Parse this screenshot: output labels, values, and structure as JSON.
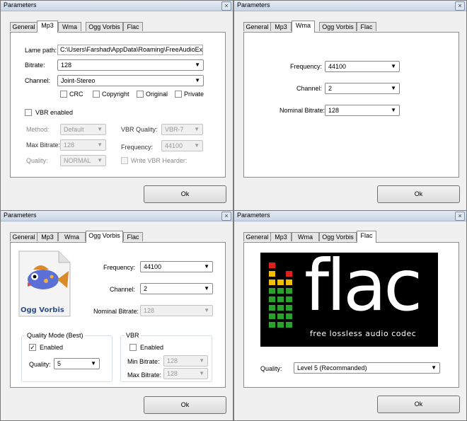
{
  "tabs": [
    "General",
    "Mp3",
    "Wma",
    "Ogg Vorbis",
    "Flac"
  ],
  "dialogs": [
    {
      "title": "Parameters",
      "close_glyph": "×",
      "ok_label": "Ok"
    },
    {
      "title": "Parameters",
      "close_glyph": "×",
      "ok_label": "Ok"
    },
    {
      "title": "Parameters",
      "close_glyph": "×",
      "ok_label": "Ok"
    },
    {
      "title": "Parameters",
      "close_glyph": "×",
      "ok_label": "Ok"
    }
  ],
  "mp3": {
    "lame_path_label": "Lame path:",
    "lame_path_value": "C:\\Users\\Farshad\\AppData\\Roaming\\FreeAudioExt",
    "bitrate_label": "Bitrate:",
    "bitrate_value": "128",
    "channel_label": "Channel:",
    "channel_value": "Joint-Stereo",
    "crc": "CRC",
    "copyright": "Copyright",
    "original": "Original",
    "private": "Private",
    "vbr_enabled": "VBR enabled",
    "method_label": "Method:",
    "method_value": "Default",
    "vbr_quality_label": "VBR Quality:",
    "vbr_quality_value": "VBR-7",
    "max_bitrate_label": "Max Bitrate:",
    "max_bitrate_value": "128",
    "frequency_label": "Frequency:",
    "frequency_value": "44100",
    "quality_label": "Quality:",
    "quality_value": "NORMAL",
    "write_vbr_header": "Write VBR Hearder:"
  },
  "wma": {
    "frequency_label": "Frequency:",
    "frequency_value": "44100",
    "channel_label": "Channel:",
    "channel_value": "2",
    "nominal_bitrate_label": "Nominal Bitrate:",
    "nominal_bitrate_value": "128"
  },
  "ogg": {
    "logo_text": "Ogg Vorbis",
    "frequency_label": "Frequency:",
    "frequency_value": "44100",
    "channel_label": "Channel:",
    "channel_value": "2",
    "nominal_bitrate_label": "Nominal Bitrate:",
    "nominal_bitrate_value": "128",
    "quality_mode_title": "Quality Mode (Best)",
    "qm_enabled": "Enabled",
    "quality_label": "Quality:",
    "quality_value": "5",
    "vbr_title": "VBR",
    "vbr_enabled": "Enabled",
    "min_bitrate_label": "Min Bitrate:",
    "min_bitrate_value": "128",
    "max_bitrate_label": "Max Bitrate:",
    "max_bitrate_value": "128"
  },
  "flac": {
    "logo_word": "flac",
    "logo_tagline": "free lossless audio codec",
    "quality_label": "Quality:",
    "quality_value": "Level 5 (Recommanded)"
  },
  "glyphs": {
    "dropdown_arrow": "▼",
    "check": "✓"
  },
  "colors": {
    "titlebar": "#c9d6e6",
    "flac_bg": "#000000",
    "ogg_fish": "#5b6fd6"
  }
}
